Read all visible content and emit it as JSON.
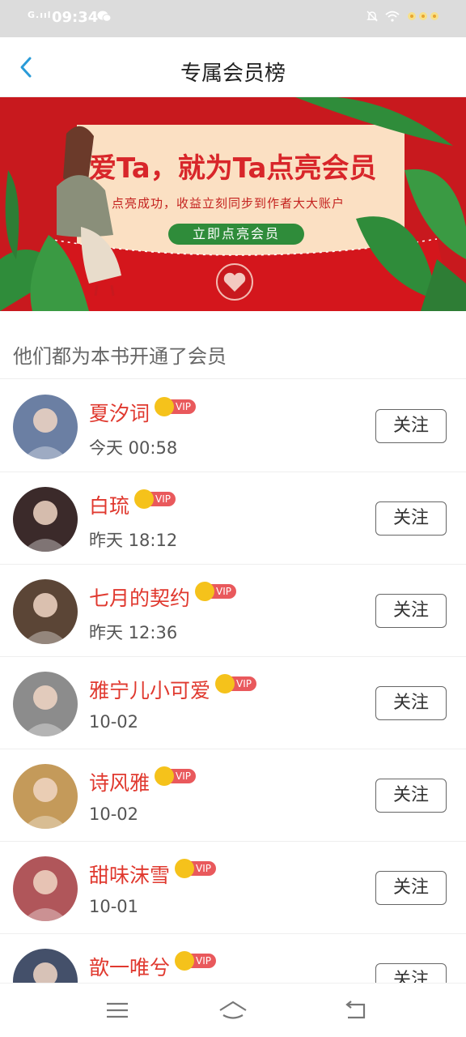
{
  "status_bar": {
    "signal": "G.ııl",
    "time": "09:34"
  },
  "header": {
    "title": "专属会员榜"
  },
  "banner": {
    "title": "爱Ta，就为Ta点亮会员",
    "subtitle": "点亮成功，收益立刻同步到作者大大账户",
    "button": "立即点亮会员"
  },
  "section": {
    "title": "他们都为本书开通了会员"
  },
  "members": [
    {
      "name": "夏汐词",
      "time": "今天 00:58",
      "vip": "VIP",
      "follow": "关注",
      "avatar_color": "#6b7fa3"
    },
    {
      "name": "白琉",
      "time": "昨天 18:12",
      "vip": "VIP",
      "follow": "关注",
      "avatar_color": "#3b2a2a"
    },
    {
      "name": "七月的契约",
      "time": "昨天 12:36",
      "vip": "VIP",
      "follow": "关注",
      "avatar_color": "#5b4536"
    },
    {
      "name": "雅宁儿小可爱",
      "time": "10-02",
      "vip": "VIP",
      "follow": "关注",
      "avatar_color": "#8c8c8c"
    },
    {
      "name": "诗风雅",
      "time": "10-02",
      "vip": "VIP",
      "follow": "关注",
      "avatar_color": "#c49a5a"
    },
    {
      "name": "甜味沫雪",
      "time": "10-01",
      "vip": "VIP",
      "follow": "关注",
      "avatar_color": "#b0565a"
    },
    {
      "name": "歆一唯兮",
      "time": "",
      "vip": "VIP",
      "follow": "关注",
      "avatar_color": "#44506a"
    }
  ],
  "colors": {
    "accent_red": "#e0392f",
    "vip_tag": "#e9595c",
    "crown": "#f5c21b",
    "banner_bg": "#c8191e",
    "banner_button": "#2f8c3a"
  }
}
